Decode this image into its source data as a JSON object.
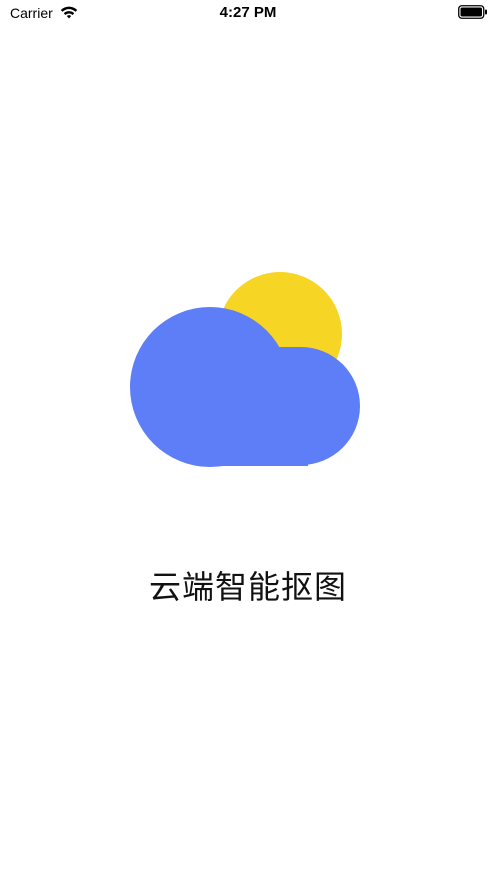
{
  "status_bar": {
    "carrier": "Carrier",
    "time": "4:27 PM",
    "wifi_icon": "wifi-icon",
    "battery_icon": "battery-icon"
  },
  "splash": {
    "logo_icon": "cloud-sun-icon",
    "app_name": "云端智能抠图"
  },
  "colors": {
    "cloud": "#5E7EF8",
    "sun": "#F7D524",
    "background": "#FFFFFF"
  }
}
